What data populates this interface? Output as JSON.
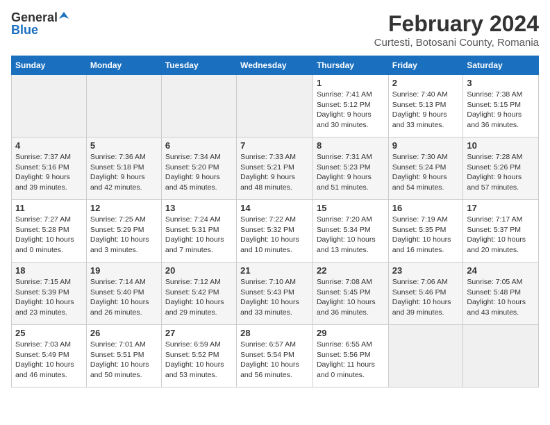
{
  "header": {
    "logo_general": "General",
    "logo_blue": "Blue",
    "title": "February 2024",
    "subtitle": "Curtesti, Botosani County, Romania"
  },
  "calendar": {
    "days_of_week": [
      "Sunday",
      "Monday",
      "Tuesday",
      "Wednesday",
      "Thursday",
      "Friday",
      "Saturday"
    ],
    "weeks": [
      [
        {
          "day": "",
          "info": ""
        },
        {
          "day": "",
          "info": ""
        },
        {
          "day": "",
          "info": ""
        },
        {
          "day": "",
          "info": ""
        },
        {
          "day": "1",
          "info": "Sunrise: 7:41 AM\nSunset: 5:12 PM\nDaylight: 9 hours\nand 30 minutes."
        },
        {
          "day": "2",
          "info": "Sunrise: 7:40 AM\nSunset: 5:13 PM\nDaylight: 9 hours\nand 33 minutes."
        },
        {
          "day": "3",
          "info": "Sunrise: 7:38 AM\nSunset: 5:15 PM\nDaylight: 9 hours\nand 36 minutes."
        }
      ],
      [
        {
          "day": "4",
          "info": "Sunrise: 7:37 AM\nSunset: 5:16 PM\nDaylight: 9 hours\nand 39 minutes."
        },
        {
          "day": "5",
          "info": "Sunrise: 7:36 AM\nSunset: 5:18 PM\nDaylight: 9 hours\nand 42 minutes."
        },
        {
          "day": "6",
          "info": "Sunrise: 7:34 AM\nSunset: 5:20 PM\nDaylight: 9 hours\nand 45 minutes."
        },
        {
          "day": "7",
          "info": "Sunrise: 7:33 AM\nSunset: 5:21 PM\nDaylight: 9 hours\nand 48 minutes."
        },
        {
          "day": "8",
          "info": "Sunrise: 7:31 AM\nSunset: 5:23 PM\nDaylight: 9 hours\nand 51 minutes."
        },
        {
          "day": "9",
          "info": "Sunrise: 7:30 AM\nSunset: 5:24 PM\nDaylight: 9 hours\nand 54 minutes."
        },
        {
          "day": "10",
          "info": "Sunrise: 7:28 AM\nSunset: 5:26 PM\nDaylight: 9 hours\nand 57 minutes."
        }
      ],
      [
        {
          "day": "11",
          "info": "Sunrise: 7:27 AM\nSunset: 5:28 PM\nDaylight: 10 hours\nand 0 minutes."
        },
        {
          "day": "12",
          "info": "Sunrise: 7:25 AM\nSunset: 5:29 PM\nDaylight: 10 hours\nand 3 minutes."
        },
        {
          "day": "13",
          "info": "Sunrise: 7:24 AM\nSunset: 5:31 PM\nDaylight: 10 hours\nand 7 minutes."
        },
        {
          "day": "14",
          "info": "Sunrise: 7:22 AM\nSunset: 5:32 PM\nDaylight: 10 hours\nand 10 minutes."
        },
        {
          "day": "15",
          "info": "Sunrise: 7:20 AM\nSunset: 5:34 PM\nDaylight: 10 hours\nand 13 minutes."
        },
        {
          "day": "16",
          "info": "Sunrise: 7:19 AM\nSunset: 5:35 PM\nDaylight: 10 hours\nand 16 minutes."
        },
        {
          "day": "17",
          "info": "Sunrise: 7:17 AM\nSunset: 5:37 PM\nDaylight: 10 hours\nand 20 minutes."
        }
      ],
      [
        {
          "day": "18",
          "info": "Sunrise: 7:15 AM\nSunset: 5:39 PM\nDaylight: 10 hours\nand 23 minutes."
        },
        {
          "day": "19",
          "info": "Sunrise: 7:14 AM\nSunset: 5:40 PM\nDaylight: 10 hours\nand 26 minutes."
        },
        {
          "day": "20",
          "info": "Sunrise: 7:12 AM\nSunset: 5:42 PM\nDaylight: 10 hours\nand 29 minutes."
        },
        {
          "day": "21",
          "info": "Sunrise: 7:10 AM\nSunset: 5:43 PM\nDaylight: 10 hours\nand 33 minutes."
        },
        {
          "day": "22",
          "info": "Sunrise: 7:08 AM\nSunset: 5:45 PM\nDaylight: 10 hours\nand 36 minutes."
        },
        {
          "day": "23",
          "info": "Sunrise: 7:06 AM\nSunset: 5:46 PM\nDaylight: 10 hours\nand 39 minutes."
        },
        {
          "day": "24",
          "info": "Sunrise: 7:05 AM\nSunset: 5:48 PM\nDaylight: 10 hours\nand 43 minutes."
        }
      ],
      [
        {
          "day": "25",
          "info": "Sunrise: 7:03 AM\nSunset: 5:49 PM\nDaylight: 10 hours\nand 46 minutes."
        },
        {
          "day": "26",
          "info": "Sunrise: 7:01 AM\nSunset: 5:51 PM\nDaylight: 10 hours\nand 50 minutes."
        },
        {
          "day": "27",
          "info": "Sunrise: 6:59 AM\nSunset: 5:52 PM\nDaylight: 10 hours\nand 53 minutes."
        },
        {
          "day": "28",
          "info": "Sunrise: 6:57 AM\nSunset: 5:54 PM\nDaylight: 10 hours\nand 56 minutes."
        },
        {
          "day": "29",
          "info": "Sunrise: 6:55 AM\nSunset: 5:56 PM\nDaylight: 11 hours\nand 0 minutes."
        },
        {
          "day": "",
          "info": ""
        },
        {
          "day": "",
          "info": ""
        }
      ]
    ]
  }
}
